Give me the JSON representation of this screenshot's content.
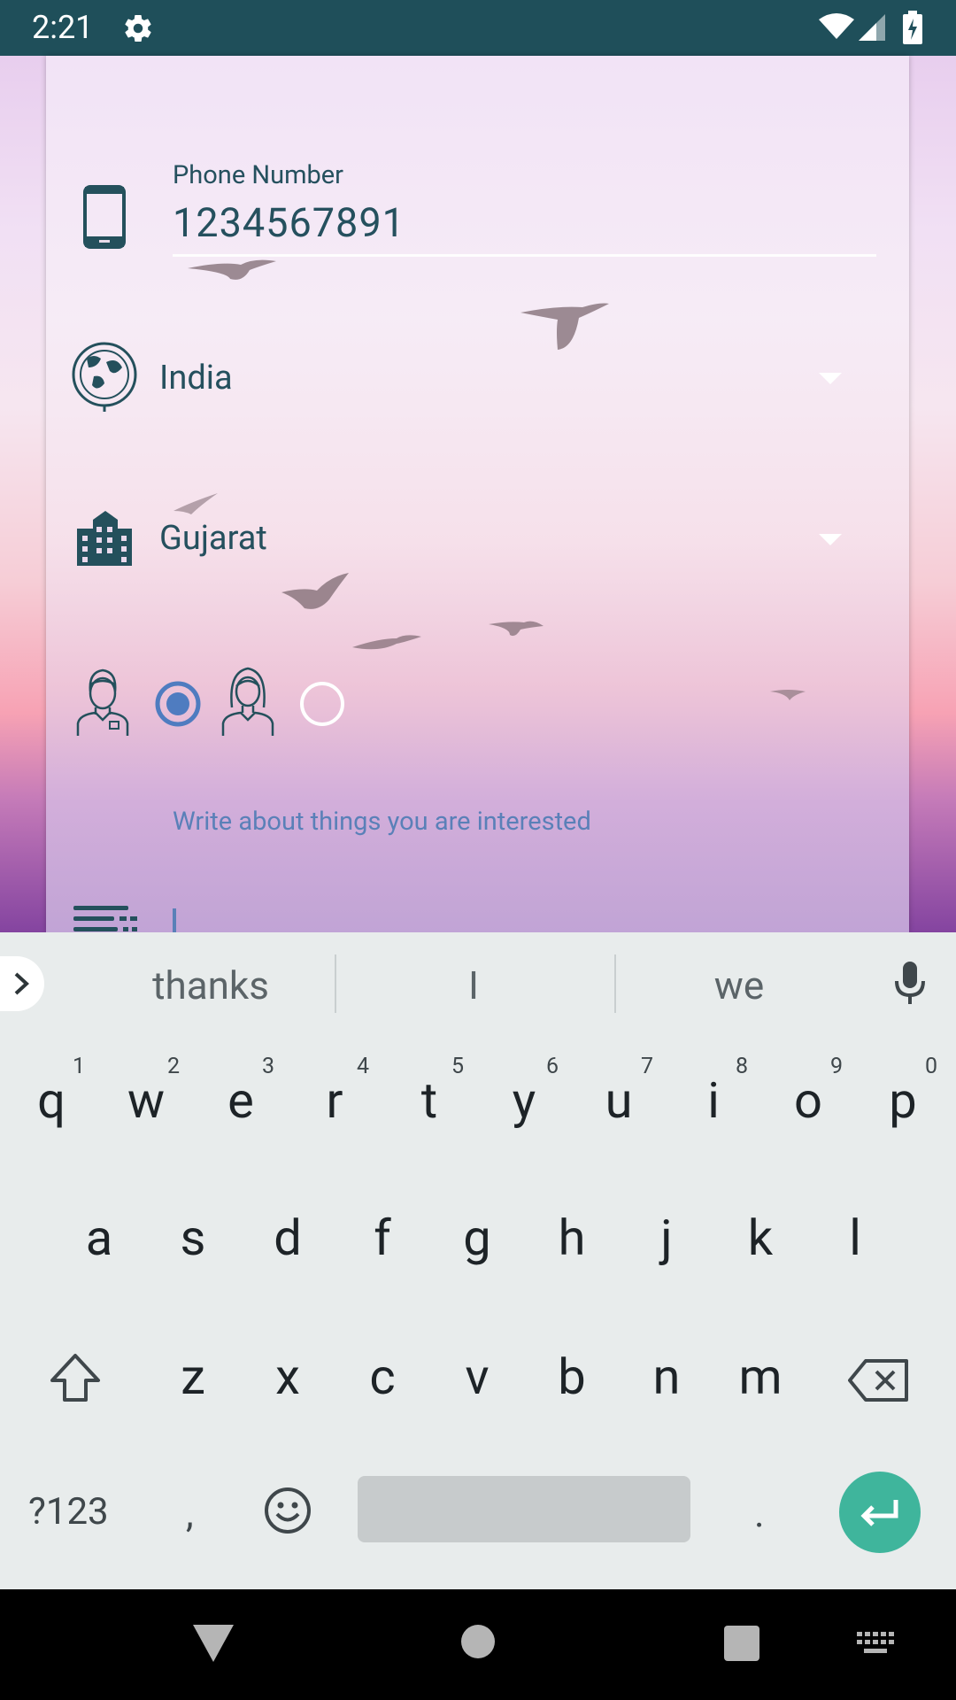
{
  "status_bar": {
    "time": "2:21"
  },
  "form": {
    "phone_label": "Phone Number",
    "phone_value": "1234567891",
    "country": "India",
    "state": "Gujarat",
    "gender_selected": "male",
    "interests_hint": "Write about things you are interested",
    "interests_value": ""
  },
  "keyboard": {
    "suggestions": [
      "thanks",
      "I",
      "we"
    ],
    "row1": [
      "q",
      "w",
      "e",
      "r",
      "t",
      "y",
      "u",
      "i",
      "o",
      "p"
    ],
    "row1_numbers": [
      "1",
      "2",
      "3",
      "4",
      "5",
      "6",
      "7",
      "8",
      "9",
      "0"
    ],
    "row2": [
      "a",
      "s",
      "d",
      "f",
      "g",
      "h",
      "j",
      "k",
      "l"
    ],
    "row3": [
      "z",
      "x",
      "c",
      "v",
      "b",
      "n",
      "m"
    ],
    "symbols_label": "?123",
    "comma": ",",
    "period": "."
  },
  "colors": {
    "status_bar": "#1f4f5a",
    "text": "#25505e",
    "accent": "#5a80b8",
    "enter_key": "#3fb59c"
  }
}
